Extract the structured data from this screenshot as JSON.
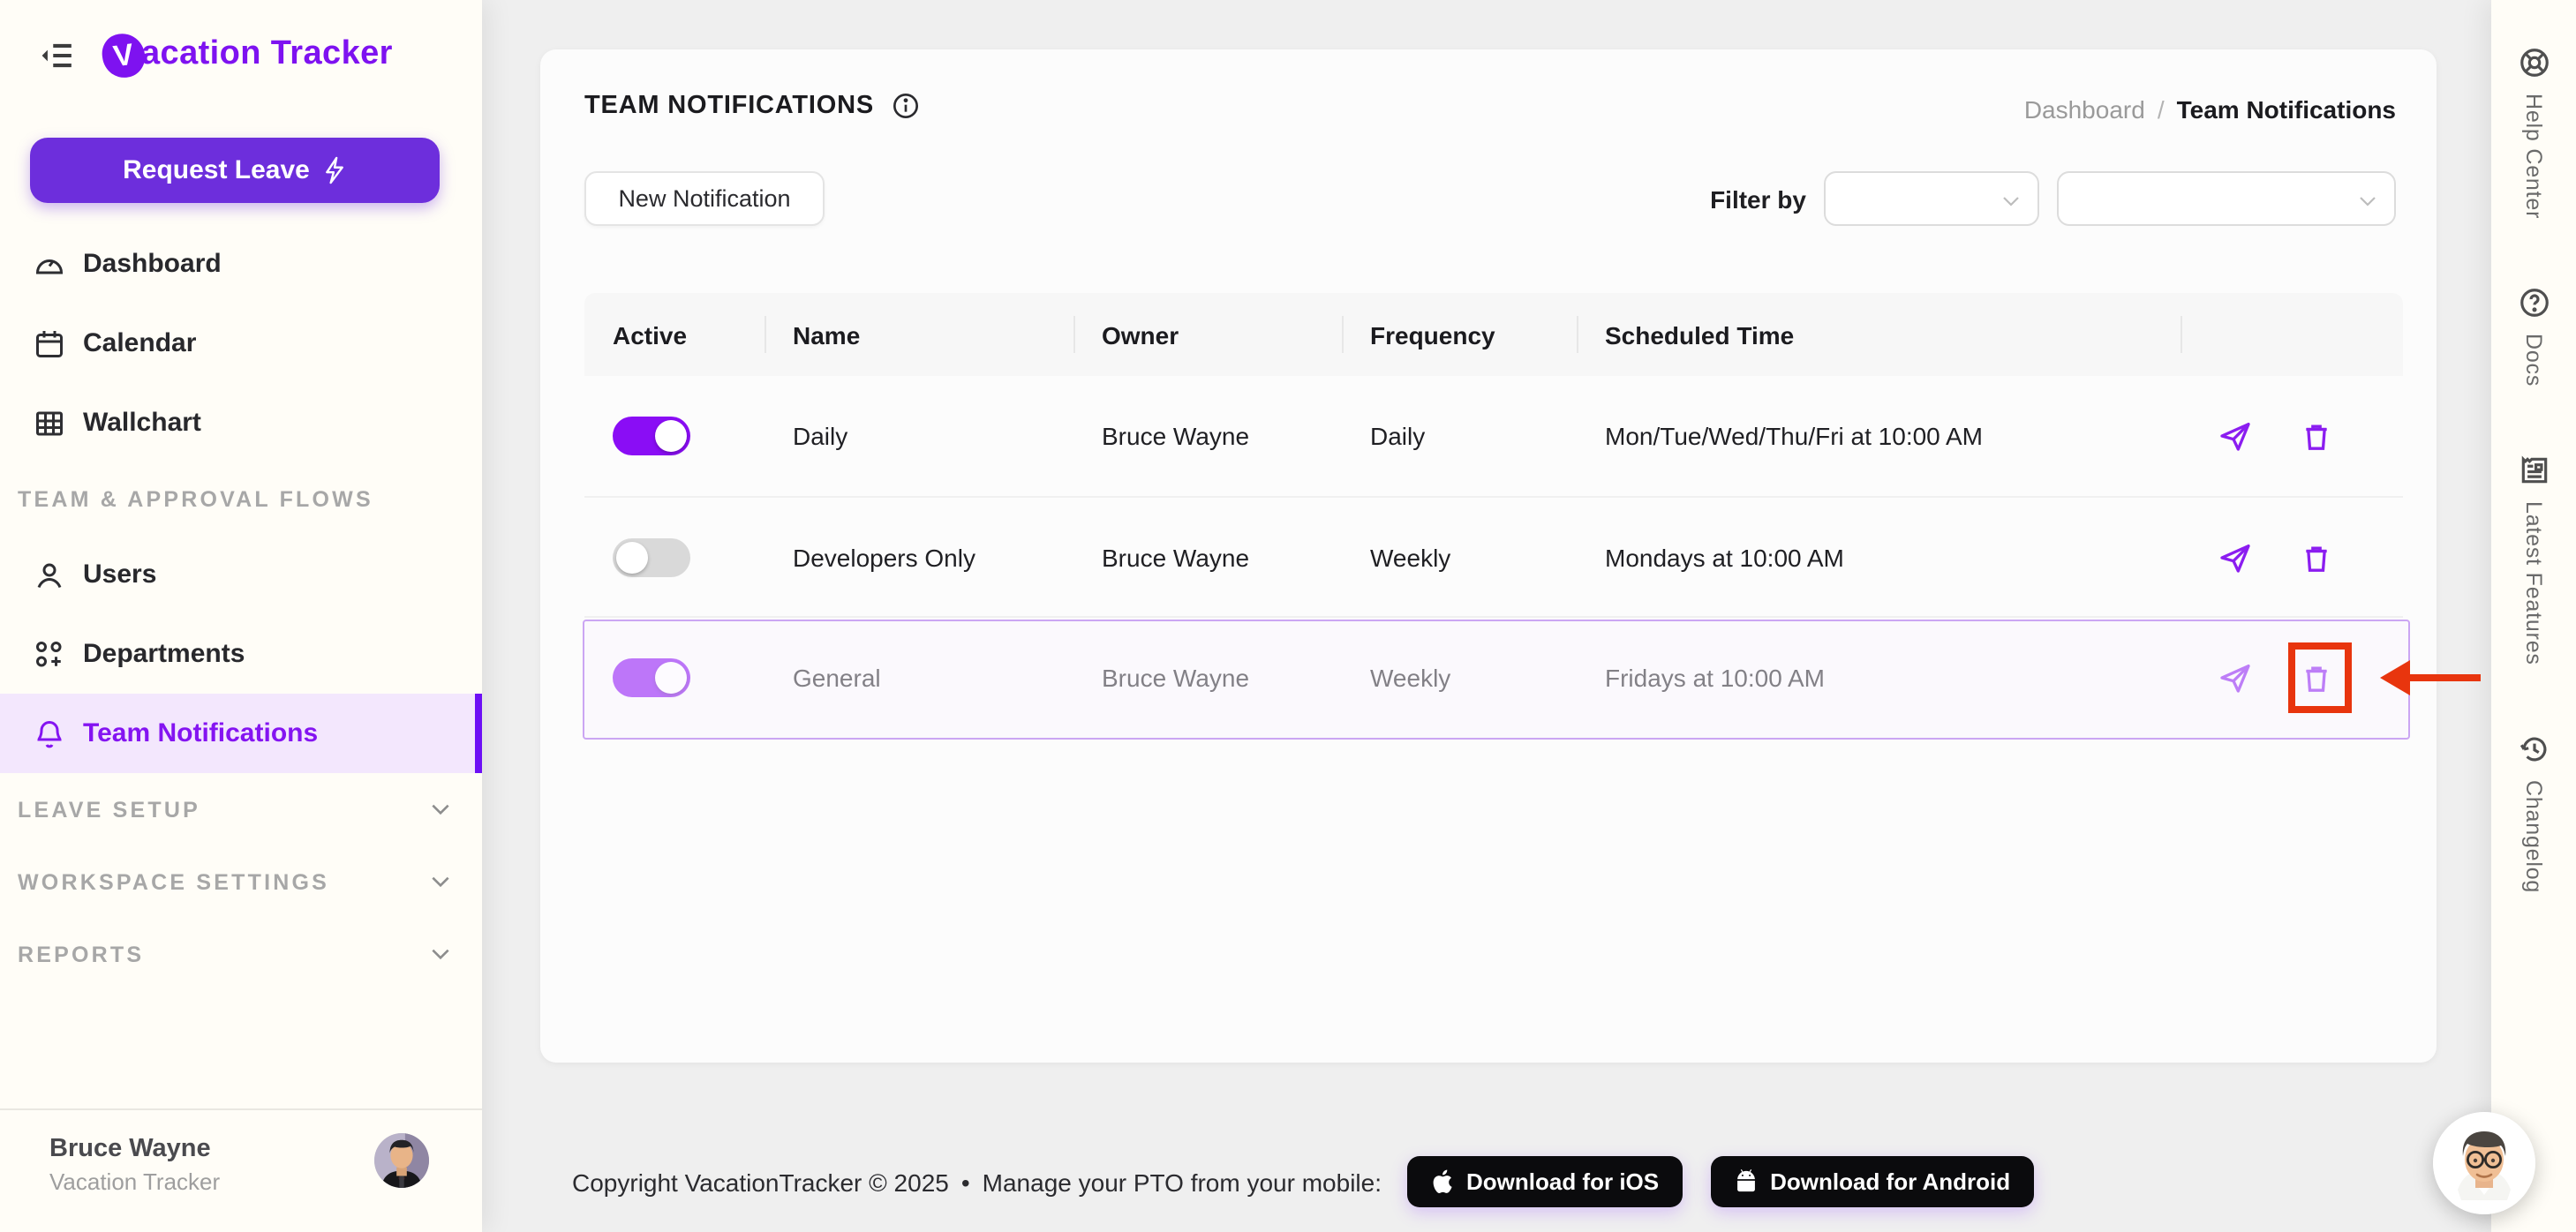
{
  "brand": {
    "logo_initial": "V",
    "logo_rest": "acation Tracker",
    "purple": "#7E12F0"
  },
  "sidebar": {
    "request_leave_label": "Request Leave",
    "items": [
      {
        "label": "Dashboard"
      },
      {
        "label": "Calendar"
      },
      {
        "label": "Wallchart"
      },
      {
        "label": "Users"
      },
      {
        "label": "Departments"
      },
      {
        "label": "Team Notifications",
        "active": true
      }
    ],
    "section_team": "TEAM & APPROVAL FLOWS",
    "sections_collapsed": [
      {
        "label": "LEAVE SETUP"
      },
      {
        "label": "WORKSPACE SETTINGS"
      },
      {
        "label": "REPORTS"
      }
    ],
    "user": {
      "name": "Bruce Wayne",
      "org": "Vacation Tracker"
    }
  },
  "header": {
    "title": "TEAM NOTIFICATIONS",
    "breadcrumb": {
      "parent": "Dashboard",
      "separator": "/",
      "current": "Team Notifications"
    },
    "new_notification_label": "New Notification",
    "filter_label": "Filter by"
  },
  "table": {
    "columns": [
      "Active",
      "Name",
      "Owner",
      "Frequency",
      "Scheduled Time"
    ],
    "rows": [
      {
        "active_class": "on",
        "name": "Daily",
        "owner": "Bruce Wayne",
        "frequency": "Daily",
        "scheduled": "Mon/Tue/Wed/Thu/Fri at 10:00 AM"
      },
      {
        "active_class": "off",
        "name": "Developers Only",
        "owner": "Bruce Wayne",
        "frequency": "Weekly",
        "scheduled": "Mondays at 10:00 AM"
      },
      {
        "active_class": "on",
        "name": "General",
        "owner": "Bruce Wayne",
        "frequency": "Weekly",
        "scheduled": "Fridays at 10:00 AM",
        "highlighted": true
      }
    ]
  },
  "right_strip": {
    "items": [
      {
        "label": "Help Center"
      },
      {
        "label": "Docs"
      },
      {
        "label": "Latest Features"
      },
      {
        "label": "Changelog"
      }
    ]
  },
  "footer": {
    "copyright": "Copyright VacationTracker © 2025",
    "bullet": "•",
    "mobile_text": "Manage your PTO from your mobile:",
    "ios_label": "Download for iOS",
    "android_label": "Download for Android"
  },
  "annotation": {
    "color": "#E8350E",
    "target": "delete-button-row-general"
  },
  "colors": {
    "accent_purple": "#7E12F0",
    "button_purple": "#6D2EDC",
    "toggle_on": "#8A0DF5",
    "active_item_bg": "#F3E7FD",
    "highlight_border": "#CBA6F3",
    "annotation_red": "#E8350E",
    "sidebar_bg": "#FFFDF7",
    "main_bg": "#EFEFEF",
    "card_bg": "#FCFCFC"
  }
}
